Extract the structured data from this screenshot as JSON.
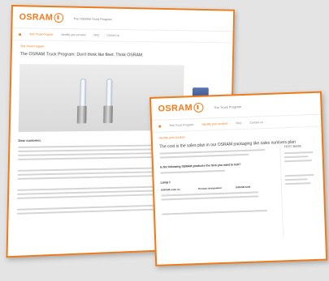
{
  "back_window": {
    "logo_text": "OSRAM",
    "program_title": "The OSRAM Truck Program",
    "nav_items": [
      "Test Truck Program",
      "Identify your product",
      "FAQ",
      "Contact us"
    ],
    "breadcrumb": "Test Truck Program",
    "page_title": "The OSRAM Truck Program: Don't think like fleet. Think OSRAM.",
    "section_heading": "Dear customer,"
  },
  "front_window": {
    "logo_text": "OSRAM",
    "program_title": "The Truck Program",
    "nav_items": [
      "Test Truck Program",
      "Identify your product",
      "FAQ",
      "Contact us"
    ],
    "breadcrumb": "Identify your product",
    "page_title": "The cost is the sales plan in our OSRAM packaging like sales numbers plan",
    "question_heading": "Is the following OSRAM products the item you want to test?",
    "list_heading": "Lamp 1",
    "table_headers": [
      "OSRAM code no.",
      "Product designation",
      "OSRAM EAN"
    ],
    "side_heading": "TEST BASE"
  },
  "colors": {
    "accent": "#f07a1a",
    "background": "#e4e4e4"
  }
}
